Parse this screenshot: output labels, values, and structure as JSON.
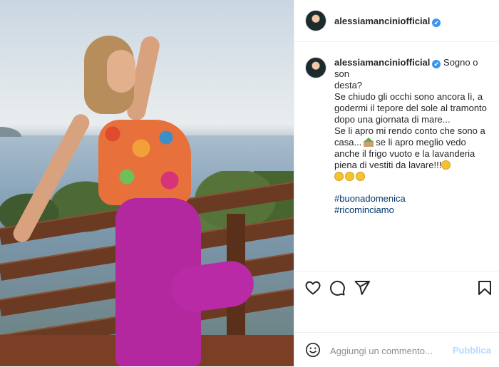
{
  "header": {
    "username": "alessiamanciniofficial",
    "verified_badge": "✔"
  },
  "caption": {
    "username": "alessiamanciniofficial",
    "verified_badge": "✔",
    "first_line": "Sogno o son",
    "lines": [
      "desta?",
      "Se chiudo gli occhi sono ancora lì, a",
      "godermi il tepore del sole al tramonto",
      "dopo una giornata di mare...",
      "Se li apro mi rendo conto che sono a"
    ],
    "line_casa_a": "casa...",
    "line_casa_b": "se li apro meglio vedo",
    "lines2": [
      "anche il frigo vuoto e la lavanderia"
    ],
    "line_last": "piena di vestiti da lavare!!!",
    "hashtags": [
      "#buonadomenica",
      "#ricominciamo"
    ]
  },
  "icons": {
    "like": "heart-icon",
    "comment": "comment-icon",
    "share": "paper-plane-icon",
    "save": "bookmark-icon",
    "emoji": "smiley-icon",
    "house": "house-with-garden-emoji",
    "laugh": "grinning-sweat-emoji",
    "weary": "weary-face-emoji"
  },
  "comment_box": {
    "placeholder": "Aggiungi un commento...",
    "post_label": "Pubblica"
  },
  "colors": {
    "link": "#00376b",
    "verified": "#3897f0",
    "post_disabled": "#b3dbff"
  }
}
